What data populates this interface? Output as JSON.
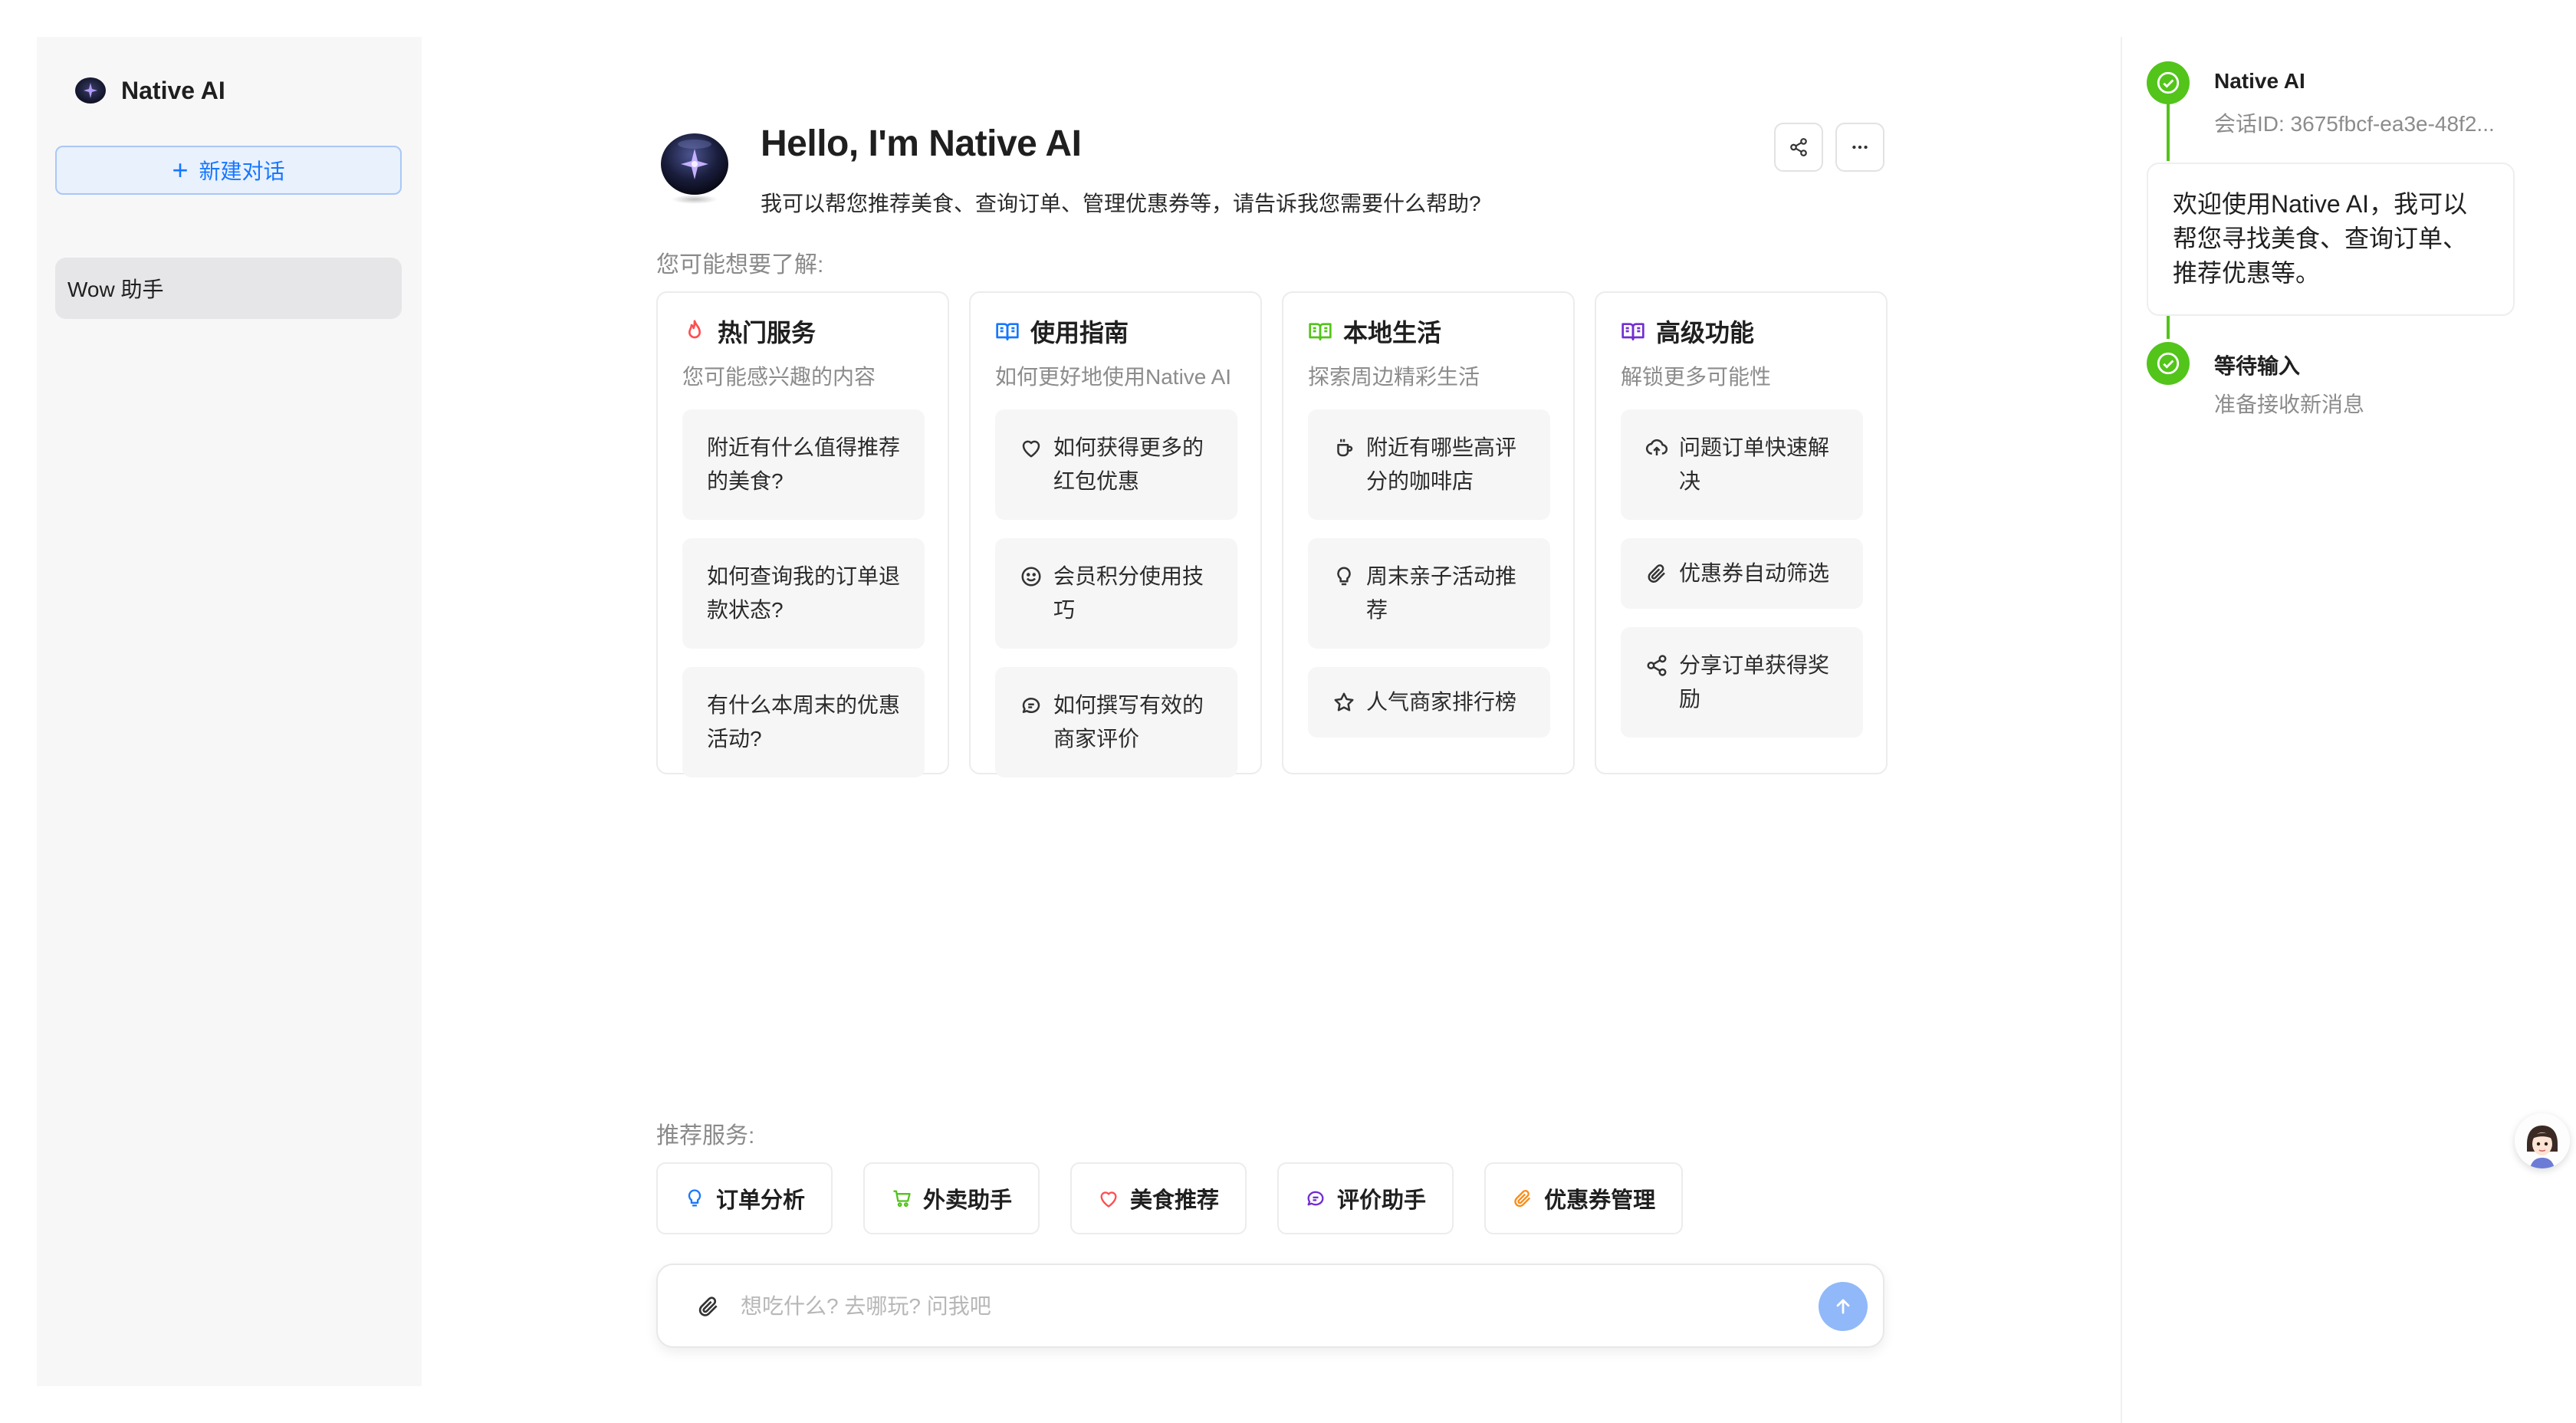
{
  "app": {
    "name": "Native AI"
  },
  "sidebar": {
    "new_chat_label": "新建对话",
    "conversations": [
      {
        "label": "Wow 助手"
      }
    ]
  },
  "header": {
    "title": "Hello, I'm Native AI",
    "description": "我可以帮您推荐美食、查询订单、管理优惠券等，请告诉我您需要什么帮助?"
  },
  "prompts": {
    "label": "您可能想要了解:",
    "cards": [
      {
        "title": "热门服务",
        "icon": "fire-icon",
        "subtitle": "您可能感兴趣的内容",
        "items": [
          {
            "label": "附近有什么值得推荐的美食?"
          },
          {
            "label": "如何查询我的订单退款状态?"
          },
          {
            "label": "有什么本周末的优惠活动?"
          }
        ]
      },
      {
        "title": "使用指南",
        "icon": "book-icon",
        "subtitle": "如何更好地使用Native AI",
        "items": [
          {
            "label": "如何获得更多的红包优惠",
            "icon": "heart-icon"
          },
          {
            "label": "会员积分使用技巧",
            "icon": "smile-icon"
          },
          {
            "label": "如何撰写有效的商家评价",
            "icon": "comment-icon"
          }
        ]
      },
      {
        "title": "本地生活",
        "icon": "book-icon",
        "subtitle": "探索周边精彩生活",
        "items": [
          {
            "label": "附近有哪些高评分的咖啡店",
            "icon": "coffee-icon"
          },
          {
            "label": "周末亲子活动推荐",
            "icon": "bulb-icon"
          },
          {
            "label": "人气商家排行榜",
            "icon": "star-icon"
          }
        ]
      },
      {
        "title": "高级功能",
        "icon": "book-icon",
        "subtitle": "解锁更多可能性",
        "items": [
          {
            "label": "问题订单快速解决",
            "icon": "cloud-upload-icon"
          },
          {
            "label": "优惠券自动筛选",
            "icon": "paperclip-icon"
          },
          {
            "label": "分享订单获得奖励",
            "icon": "share-icon"
          }
        ]
      }
    ]
  },
  "recommended": {
    "label": "推荐服务:",
    "items": [
      {
        "label": "订单分析",
        "icon": "bulb-icon"
      },
      {
        "label": "外卖助手",
        "icon": "cart-icon"
      },
      {
        "label": "美食推荐",
        "icon": "heart-icon"
      },
      {
        "label": "评价助手",
        "icon": "comment-icon"
      },
      {
        "label": "优惠券管理",
        "icon": "paperclip-icon"
      }
    ]
  },
  "composer": {
    "placeholder": "想吃什么? 去哪玩? 问我吧"
  },
  "timeline": {
    "items": [
      {
        "title": "Native AI",
        "subtitle": "会话ID: 3675fbcf-ea3e-48f2...",
        "message": "欢迎使用Native AI，我可以帮您寻找美食、查询订单、推荐优惠等。"
      },
      {
        "title": "等待输入",
        "subtitle": "准备接收新消息"
      }
    ]
  },
  "colors": {
    "accent": "#1677ff",
    "success": "#52c41a",
    "fire": "#ff4d4f",
    "guide": "#1677ff",
    "local": "#52c41a",
    "advanced": "#722ed1",
    "send": "#91b8f8"
  }
}
